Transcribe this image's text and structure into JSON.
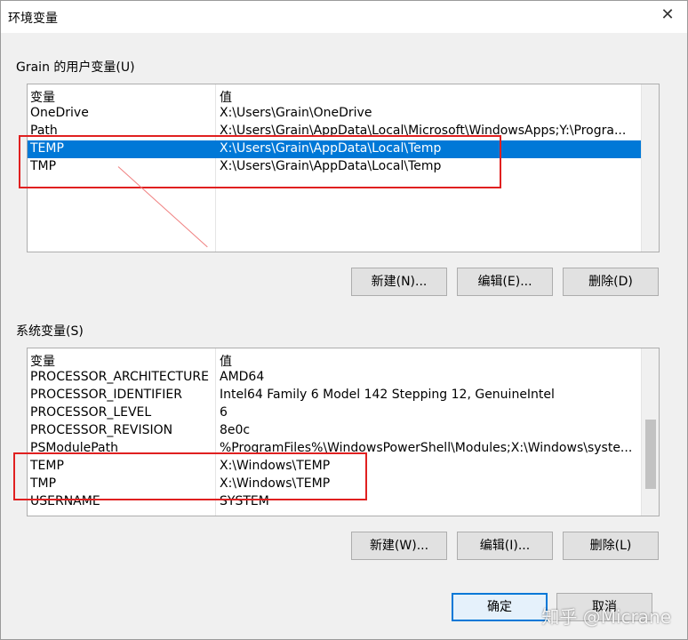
{
  "window": {
    "title": "环境变量",
    "close_glyph": "✕"
  },
  "user_vars": {
    "group_label": "Grain 的用户变量(U)",
    "header": {
      "name": "变量",
      "value": "值"
    },
    "rows": [
      {
        "name": "OneDrive",
        "value": "X:\\Users\\Grain\\OneDrive"
      },
      {
        "name": "Path",
        "value": "X:\\Users\\Grain\\AppData\\Local\\Microsoft\\WindowsApps;Y:\\Progra..."
      },
      {
        "name": "TEMP",
        "value": "X:\\Users\\Grain\\AppData\\Local\\Temp",
        "selected": true
      },
      {
        "name": "TMP",
        "value": "X:\\Users\\Grain\\AppData\\Local\\Temp"
      }
    ],
    "buttons": {
      "new": "新建(N)...",
      "edit": "编辑(E)...",
      "delete": "删除(D)"
    }
  },
  "system_vars": {
    "group_label": "系统变量(S)",
    "header": {
      "name": "变量",
      "value": "值"
    },
    "rows": [
      {
        "name": "PROCESSOR_ARCHITECTURE",
        "value": "AMD64"
      },
      {
        "name": "PROCESSOR_IDENTIFIER",
        "value": "Intel64 Family 6 Model 142 Stepping 12, GenuineIntel"
      },
      {
        "name": "PROCESSOR_LEVEL",
        "value": "6"
      },
      {
        "name": "PROCESSOR_REVISION",
        "value": "8e0c"
      },
      {
        "name": "PSModulePath",
        "value": "%ProgramFiles%\\WindowsPowerShell\\Modules;X:\\Windows\\syste..."
      },
      {
        "name": "TEMP",
        "value": "X:\\Windows\\TEMP"
      },
      {
        "name": "TMP",
        "value": "X:\\Windows\\TEMP"
      },
      {
        "name": "USERNAME",
        "value": "SYSTEM"
      }
    ],
    "buttons": {
      "new": "新建(W)...",
      "edit": "编辑(I)...",
      "delete": "删除(L)"
    }
  },
  "footer": {
    "ok": "确定",
    "cancel": "取消"
  },
  "watermark": "知乎 @Micrane",
  "colors": {
    "selection": "#0078d7",
    "annotation": "#e02020"
  }
}
